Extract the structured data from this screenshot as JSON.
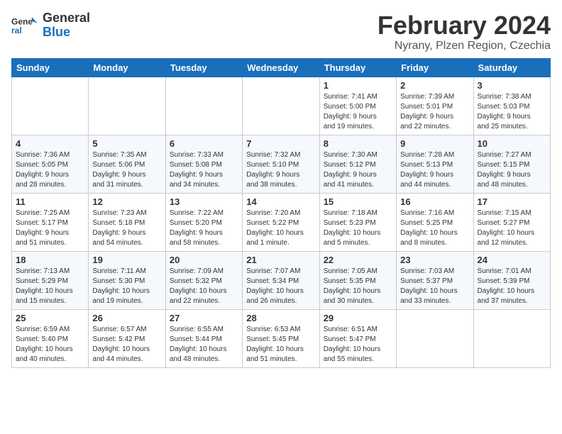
{
  "header": {
    "logo_line1": "General",
    "logo_line2": "Blue",
    "title": "February 2024",
    "subtitle": "Nyrany, Plzen Region, Czechia"
  },
  "weekdays": [
    "Sunday",
    "Monday",
    "Tuesday",
    "Wednesday",
    "Thursday",
    "Friday",
    "Saturday"
  ],
  "weeks": [
    [
      {
        "day": "",
        "info": ""
      },
      {
        "day": "",
        "info": ""
      },
      {
        "day": "",
        "info": ""
      },
      {
        "day": "",
        "info": ""
      },
      {
        "day": "1",
        "info": "Sunrise: 7:41 AM\nSunset: 5:00 PM\nDaylight: 9 hours\nand 19 minutes."
      },
      {
        "day": "2",
        "info": "Sunrise: 7:39 AM\nSunset: 5:01 PM\nDaylight: 9 hours\nand 22 minutes."
      },
      {
        "day": "3",
        "info": "Sunrise: 7:38 AM\nSunset: 5:03 PM\nDaylight: 9 hours\nand 25 minutes."
      }
    ],
    [
      {
        "day": "4",
        "info": "Sunrise: 7:36 AM\nSunset: 5:05 PM\nDaylight: 9 hours\nand 28 minutes."
      },
      {
        "day": "5",
        "info": "Sunrise: 7:35 AM\nSunset: 5:06 PM\nDaylight: 9 hours\nand 31 minutes."
      },
      {
        "day": "6",
        "info": "Sunrise: 7:33 AM\nSunset: 5:08 PM\nDaylight: 9 hours\nand 34 minutes."
      },
      {
        "day": "7",
        "info": "Sunrise: 7:32 AM\nSunset: 5:10 PM\nDaylight: 9 hours\nand 38 minutes."
      },
      {
        "day": "8",
        "info": "Sunrise: 7:30 AM\nSunset: 5:12 PM\nDaylight: 9 hours\nand 41 minutes."
      },
      {
        "day": "9",
        "info": "Sunrise: 7:28 AM\nSunset: 5:13 PM\nDaylight: 9 hours\nand 44 minutes."
      },
      {
        "day": "10",
        "info": "Sunrise: 7:27 AM\nSunset: 5:15 PM\nDaylight: 9 hours\nand 48 minutes."
      }
    ],
    [
      {
        "day": "11",
        "info": "Sunrise: 7:25 AM\nSunset: 5:17 PM\nDaylight: 9 hours\nand 51 minutes."
      },
      {
        "day": "12",
        "info": "Sunrise: 7:23 AM\nSunset: 5:18 PM\nDaylight: 9 hours\nand 54 minutes."
      },
      {
        "day": "13",
        "info": "Sunrise: 7:22 AM\nSunset: 5:20 PM\nDaylight: 9 hours\nand 58 minutes."
      },
      {
        "day": "14",
        "info": "Sunrise: 7:20 AM\nSunset: 5:22 PM\nDaylight: 10 hours\nand 1 minute."
      },
      {
        "day": "15",
        "info": "Sunrise: 7:18 AM\nSunset: 5:23 PM\nDaylight: 10 hours\nand 5 minutes."
      },
      {
        "day": "16",
        "info": "Sunrise: 7:16 AM\nSunset: 5:25 PM\nDaylight: 10 hours\nand 8 minutes."
      },
      {
        "day": "17",
        "info": "Sunrise: 7:15 AM\nSunset: 5:27 PM\nDaylight: 10 hours\nand 12 minutes."
      }
    ],
    [
      {
        "day": "18",
        "info": "Sunrise: 7:13 AM\nSunset: 5:29 PM\nDaylight: 10 hours\nand 15 minutes."
      },
      {
        "day": "19",
        "info": "Sunrise: 7:11 AM\nSunset: 5:30 PM\nDaylight: 10 hours\nand 19 minutes."
      },
      {
        "day": "20",
        "info": "Sunrise: 7:09 AM\nSunset: 5:32 PM\nDaylight: 10 hours\nand 22 minutes."
      },
      {
        "day": "21",
        "info": "Sunrise: 7:07 AM\nSunset: 5:34 PM\nDaylight: 10 hours\nand 26 minutes."
      },
      {
        "day": "22",
        "info": "Sunrise: 7:05 AM\nSunset: 5:35 PM\nDaylight: 10 hours\nand 30 minutes."
      },
      {
        "day": "23",
        "info": "Sunrise: 7:03 AM\nSunset: 5:37 PM\nDaylight: 10 hours\nand 33 minutes."
      },
      {
        "day": "24",
        "info": "Sunrise: 7:01 AM\nSunset: 5:39 PM\nDaylight: 10 hours\nand 37 minutes."
      }
    ],
    [
      {
        "day": "25",
        "info": "Sunrise: 6:59 AM\nSunset: 5:40 PM\nDaylight: 10 hours\nand 40 minutes."
      },
      {
        "day": "26",
        "info": "Sunrise: 6:57 AM\nSunset: 5:42 PM\nDaylight: 10 hours\nand 44 minutes."
      },
      {
        "day": "27",
        "info": "Sunrise: 6:55 AM\nSunset: 5:44 PM\nDaylight: 10 hours\nand 48 minutes."
      },
      {
        "day": "28",
        "info": "Sunrise: 6:53 AM\nSunset: 5:45 PM\nDaylight: 10 hours\nand 51 minutes."
      },
      {
        "day": "29",
        "info": "Sunrise: 6:51 AM\nSunset: 5:47 PM\nDaylight: 10 hours\nand 55 minutes."
      },
      {
        "day": "",
        "info": ""
      },
      {
        "day": "",
        "info": ""
      }
    ]
  ]
}
